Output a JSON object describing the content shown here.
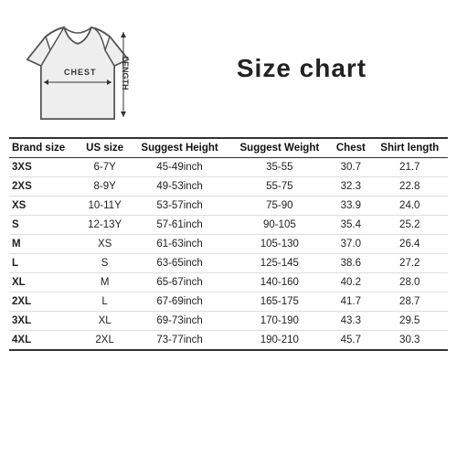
{
  "title": "Size chart",
  "diagram": {
    "chest_label": "CHEST",
    "length_label": "LENGTH"
  },
  "table": {
    "headers": [
      "Brand size",
      "US size",
      "Suggest Height",
      "Suggest Weight",
      "Chest",
      "Shirt length"
    ],
    "rows": [
      [
        "3XS",
        "6-7Y",
        "45-49inch",
        "35-55",
        "30.7",
        "21.7"
      ],
      [
        "2XS",
        "8-9Y",
        "49-53inch",
        "55-75",
        "32.3",
        "22.8"
      ],
      [
        "XS",
        "10-11Y",
        "53-57inch",
        "75-90",
        "33.9",
        "24.0"
      ],
      [
        "S",
        "12-13Y",
        "57-61inch",
        "90-105",
        "35.4",
        "25.2"
      ],
      [
        "M",
        "XS",
        "61-63inch",
        "105-130",
        "37.0",
        "26.4"
      ],
      [
        "L",
        "S",
        "63-65inch",
        "125-145",
        "38.6",
        "27.2"
      ],
      [
        "XL",
        "M",
        "65-67inch",
        "140-160",
        "40.2",
        "28.0"
      ],
      [
        "2XL",
        "L",
        "67-69inch",
        "165-175",
        "41.7",
        "28.7"
      ],
      [
        "3XL",
        "XL",
        "69-73inch",
        "170-190",
        "43.3",
        "29.5"
      ],
      [
        "4XL",
        "2XL",
        "73-77inch",
        "190-210",
        "45.7",
        "30.3"
      ]
    ]
  }
}
